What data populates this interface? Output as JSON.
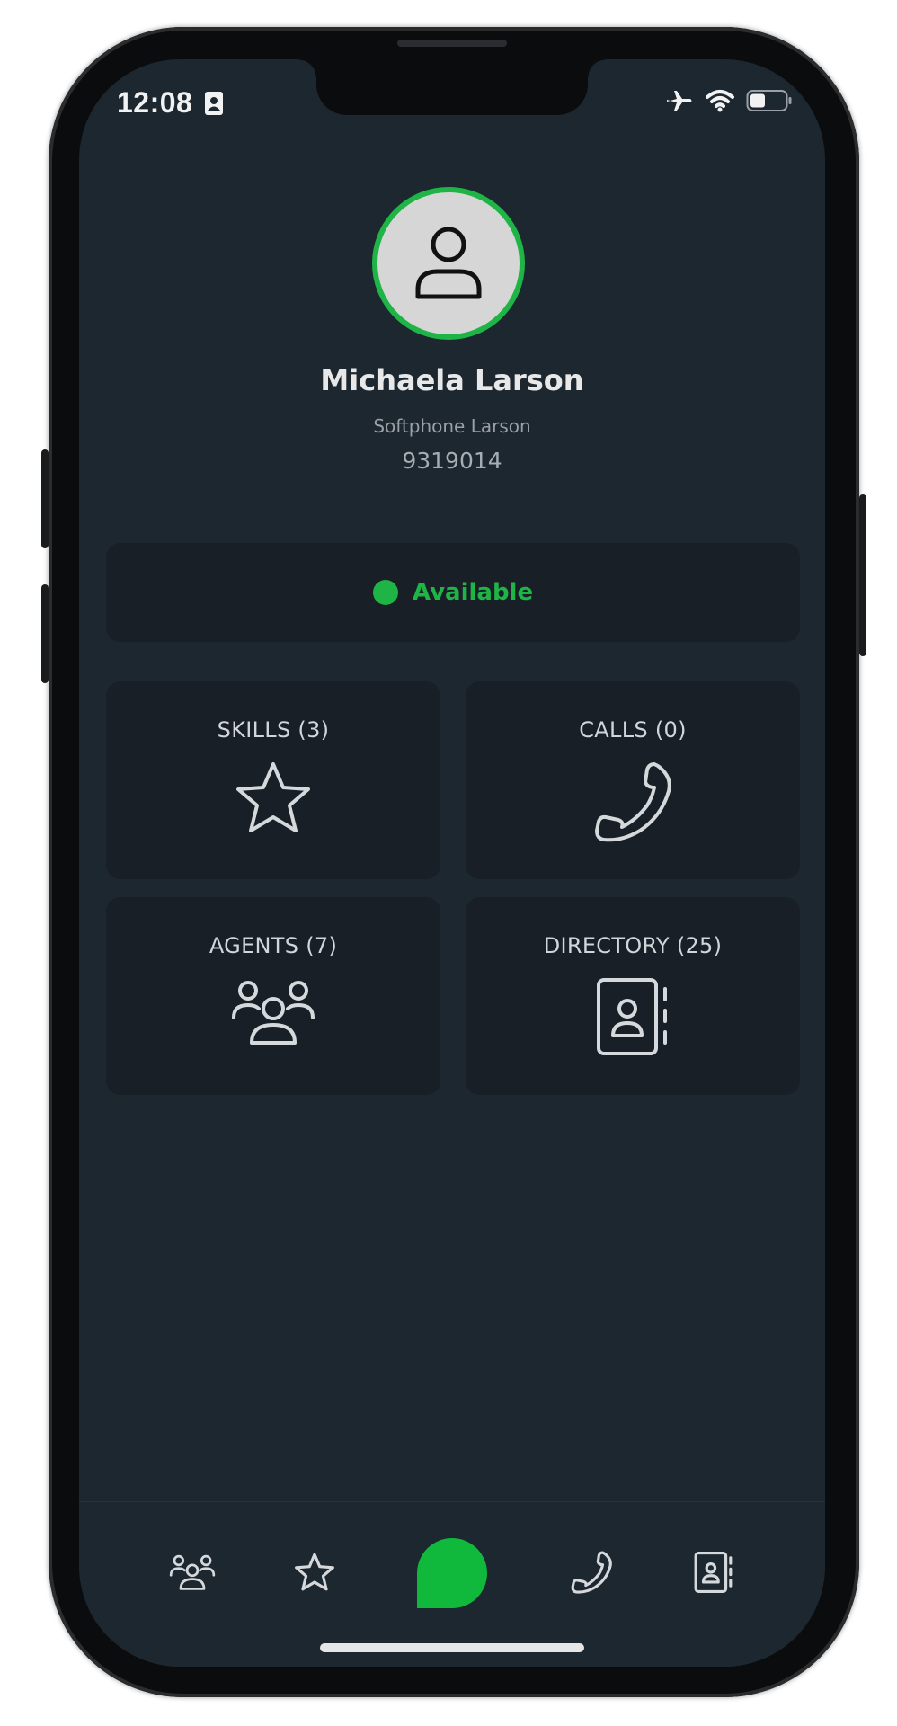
{
  "status_bar": {
    "time": "12:08"
  },
  "profile": {
    "name": "Michaela Larson",
    "device": "Softphone Larson",
    "extension": "9319014"
  },
  "presence": {
    "label": "Available",
    "color": "#1fb446"
  },
  "tiles": [
    {
      "label": "SKILLS (3)",
      "icon": "star-icon"
    },
    {
      "label": "CALLS (0)",
      "icon": "phone-icon"
    },
    {
      "label": "AGENTS (7)",
      "icon": "agents-icon"
    },
    {
      "label": "DIRECTORY (25)",
      "icon": "directory-icon"
    }
  ],
  "tab_bar": [
    {
      "icon": "agents-icon"
    },
    {
      "icon": "star-icon"
    },
    {
      "icon": "chat-bubble-icon"
    },
    {
      "icon": "phone-icon"
    },
    {
      "icon": "directory-icon"
    }
  ],
  "colors": {
    "background": "#1c2730",
    "card": "#181f26",
    "accent": "#1fb446"
  }
}
